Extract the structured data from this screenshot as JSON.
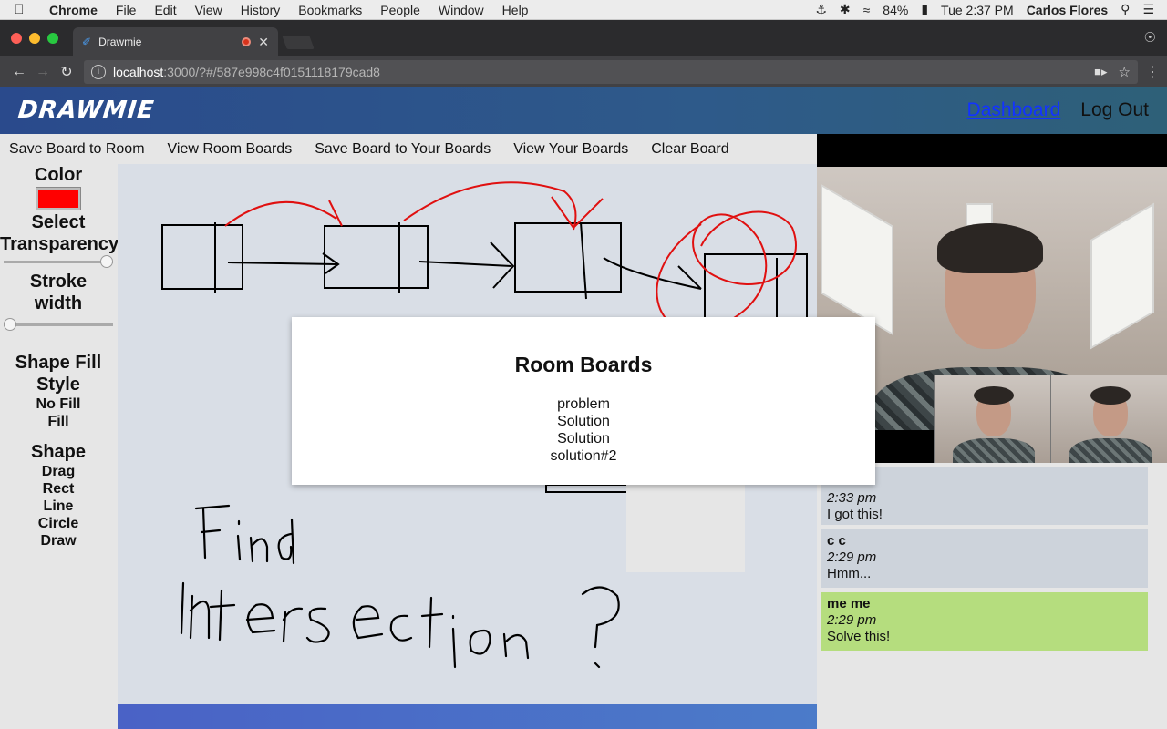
{
  "os_menu": {
    "app": "Chrome",
    "items": [
      "File",
      "Edit",
      "View",
      "History",
      "Bookmarks",
      "People",
      "Window",
      "Help"
    ],
    "battery": "84%",
    "clock": "Tue 2:37 PM",
    "user": "Carlos Flores"
  },
  "browser": {
    "tab_title": "Drawmie",
    "url_host": "localhost",
    "url_rest": ":3000/?#/587e998c4f0151118179cad8"
  },
  "app": {
    "logo": "Drawmie",
    "nav": {
      "dashboard": "Dashboard",
      "logout": "Log Out"
    },
    "actions": [
      "Save Board to Room",
      "View Room Boards",
      "Save Board to Your Boards",
      "View Your Boards",
      "Clear Board"
    ]
  },
  "tools": {
    "color_label": "Color",
    "color_value": "#ff0000",
    "transparency_label_1": "Select",
    "transparency_label_2": "Transparency",
    "transparency_level": 1.0,
    "stroke_label_1": "Stroke",
    "stroke_label_2": "width",
    "stroke_level": 0.0,
    "fill_label_1": "Shape Fill",
    "fill_label_2": "Style",
    "fill_options": [
      "No Fill",
      "Fill"
    ],
    "shape_label": "Shape",
    "shape_options": [
      "Drag",
      "Rect",
      "Line",
      "Circle",
      "Draw"
    ]
  },
  "modal": {
    "title": "Room Boards",
    "boards": [
      "problem",
      "Solution",
      "Solution",
      "solution#2"
    ]
  },
  "chat": [
    {
      "who": "",
      "time": "2:33 pm",
      "text": "I got this!"
    },
    {
      "who": "c c",
      "time": "2:29 pm",
      "text": "Hmm..."
    },
    {
      "who": "me me",
      "time": "2:29 pm",
      "text": "Solve this!"
    }
  ]
}
